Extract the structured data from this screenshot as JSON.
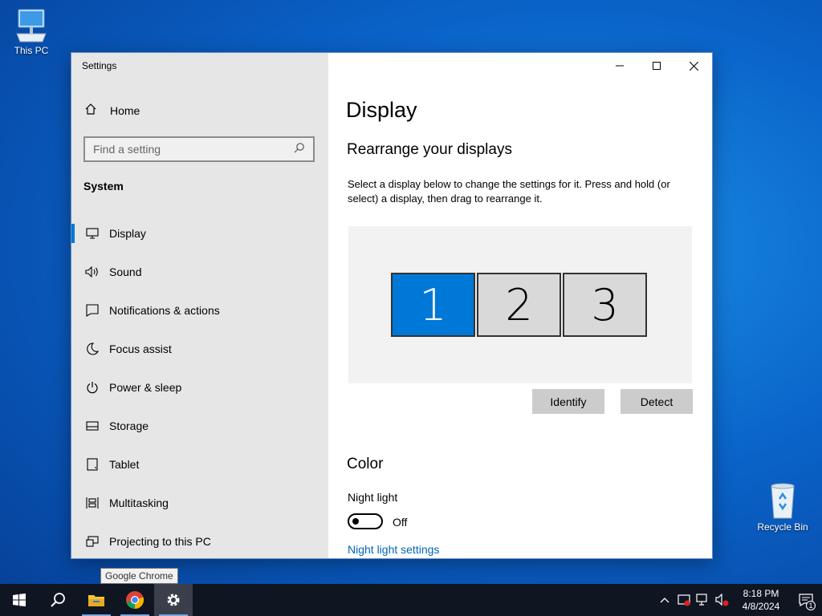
{
  "desktop": {
    "icons": [
      {
        "label": "This PC",
        "icon": "computer-icon"
      },
      {
        "label": "Recycle Bin",
        "icon": "recycle-bin-icon"
      }
    ]
  },
  "window": {
    "title": "Settings",
    "controls": {
      "minimize": "minimize-icon",
      "maximize": "maximize-icon",
      "close": "close-icon"
    }
  },
  "sidebar": {
    "home_label": "Home",
    "search_placeholder": "Find a setting",
    "section": "System",
    "items": [
      {
        "label": "Display",
        "icon": "monitor-icon",
        "active": true
      },
      {
        "label": "Sound",
        "icon": "speaker-icon"
      },
      {
        "label": "Notifications & actions",
        "icon": "notification-icon"
      },
      {
        "label": "Focus assist",
        "icon": "moon-icon"
      },
      {
        "label": "Power & sleep",
        "icon": "power-icon"
      },
      {
        "label": "Storage",
        "icon": "storage-icon"
      },
      {
        "label": "Tablet",
        "icon": "tablet-icon"
      },
      {
        "label": "Multitasking",
        "icon": "multitasking-icon"
      },
      {
        "label": "Projecting to this PC",
        "icon": "projecting-icon"
      }
    ]
  },
  "main": {
    "title": "Display",
    "rearrange_heading": "Rearrange your displays",
    "rearrange_desc": "Select a display below to change the settings for it. Press and hold (or select) a display, then drag to rearrange it.",
    "monitors": [
      {
        "number": "1",
        "selected": true
      },
      {
        "number": "2",
        "selected": false
      },
      {
        "number": "3",
        "selected": false
      }
    ],
    "identify_label": "Identify",
    "detect_label": "Detect",
    "color_heading": "Color",
    "night_light_label": "Night light",
    "night_light_state": "Off",
    "night_light_link": "Night light settings"
  },
  "tooltip": "Google Chrome",
  "taskbar": {
    "apps": [
      {
        "name": "start-icon"
      },
      {
        "name": "search-icon"
      },
      {
        "name": "file-explorer-icon"
      },
      {
        "name": "chrome-icon"
      },
      {
        "name": "settings-icon"
      }
    ],
    "time": "8:18 PM",
    "date": "4/8/2024",
    "notification_count": "1"
  },
  "colors": {
    "accent": "#0078d7",
    "link": "#0066b4",
    "taskbar": "#101522"
  }
}
